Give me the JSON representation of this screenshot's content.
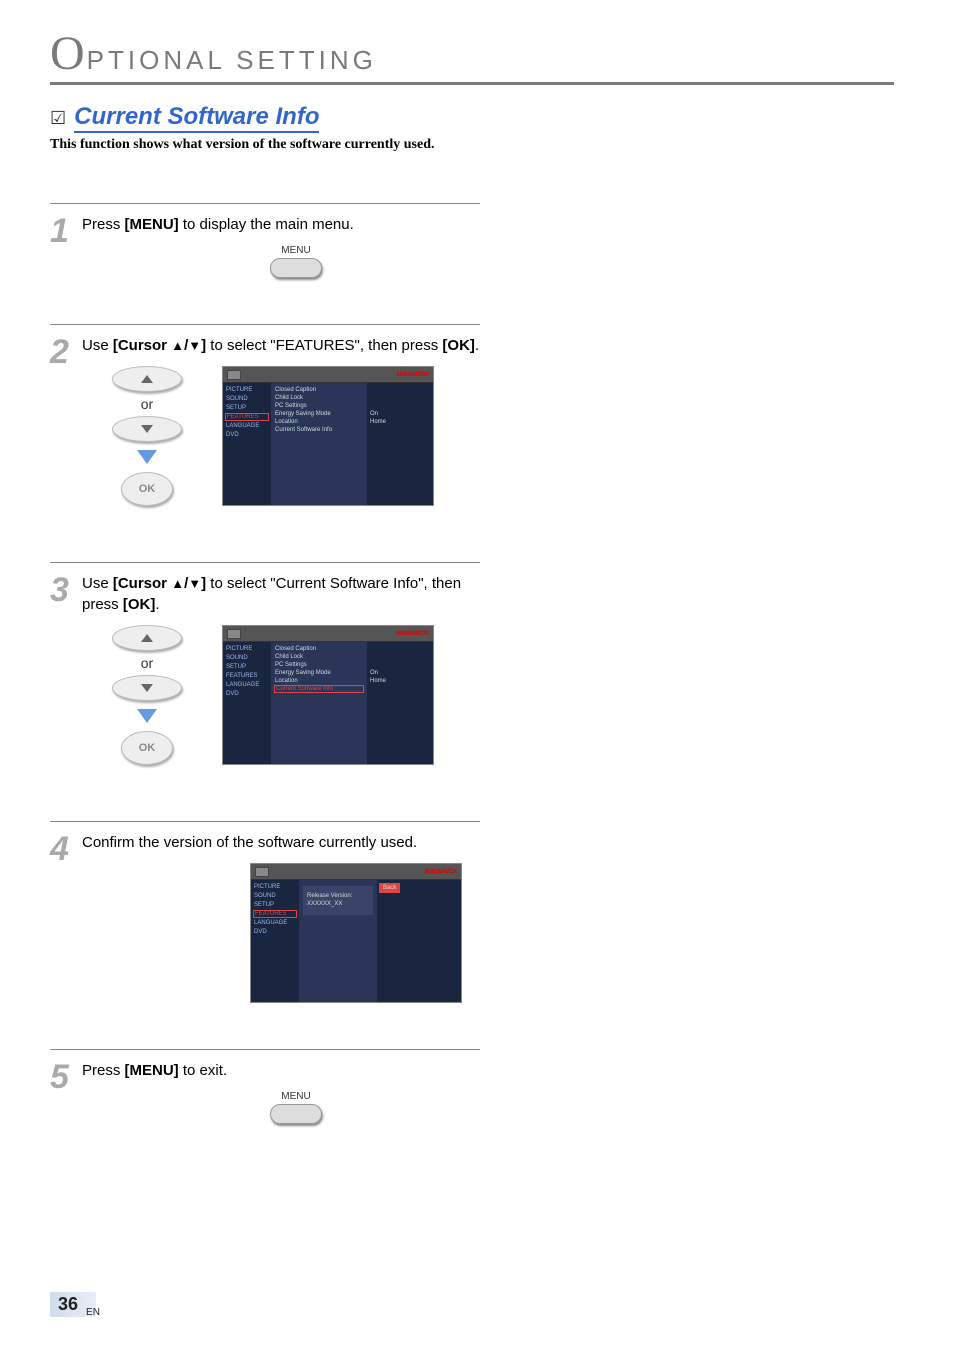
{
  "chapter": {
    "initial": "O",
    "title": "PTIONAL  SETTING"
  },
  "section": {
    "title": "Current Software Info",
    "desc": "This function shows what version of the software currently used."
  },
  "steps": {
    "s1": {
      "num": "1",
      "pre": "Press ",
      "key": "[MENU]",
      "post": " to display the main menu.",
      "btn_label": "MENU"
    },
    "s2": {
      "num": "2",
      "pre": "Use ",
      "key": "[Cursor ",
      "mid": " to select \"FEATURES\", then press ",
      "key2": "[OK]",
      "post": ".",
      "or": "or",
      "ok": "OK"
    },
    "s3": {
      "num": "3",
      "pre": "Use ",
      "key": "[Cursor ",
      "mid": " to select \"Current Software Info\", then press ",
      "key2": "[OK]",
      "post": ".",
      "or": "or",
      "ok": "OK"
    },
    "s4": {
      "num": "4",
      "text": "Confirm the version of the software currently used."
    },
    "s5": {
      "num": "5",
      "pre": "Press ",
      "key": "[MENU]",
      "post": " to exit.",
      "btn_label": "MENU"
    }
  },
  "osd": {
    "brand": "MAGNAVOX",
    "left": [
      "PICTURE",
      "SOUND",
      "SETUP",
      "FEATURES",
      "LANGUAGE",
      "DVD"
    ],
    "mid": [
      "Closed Caption",
      "Child Lock",
      "PC Settings",
      "Energy Saving Mode",
      "Location",
      "Current Software Info"
    ],
    "right_vals": {
      "esm": "On",
      "loc": "Home"
    },
    "back": "Back",
    "info": {
      "l1": "Release Version:",
      "l2": "XXXXXX_XX"
    }
  },
  "page": {
    "num": "36",
    "lang": "EN"
  }
}
